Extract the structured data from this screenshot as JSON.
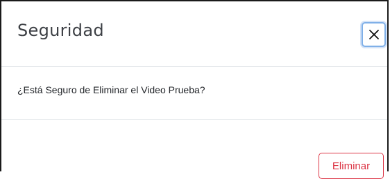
{
  "dialog": {
    "title": "Seguridad",
    "close_icon": "close-icon",
    "message": "¿Está Seguro de Eliminar el Video Prueba?",
    "delete_label": "Eliminar"
  },
  "colors": {
    "danger": "#dc3545",
    "focus_ring": "#80b0e8",
    "title_text": "#3d4045",
    "divider": "#dee2e6"
  }
}
